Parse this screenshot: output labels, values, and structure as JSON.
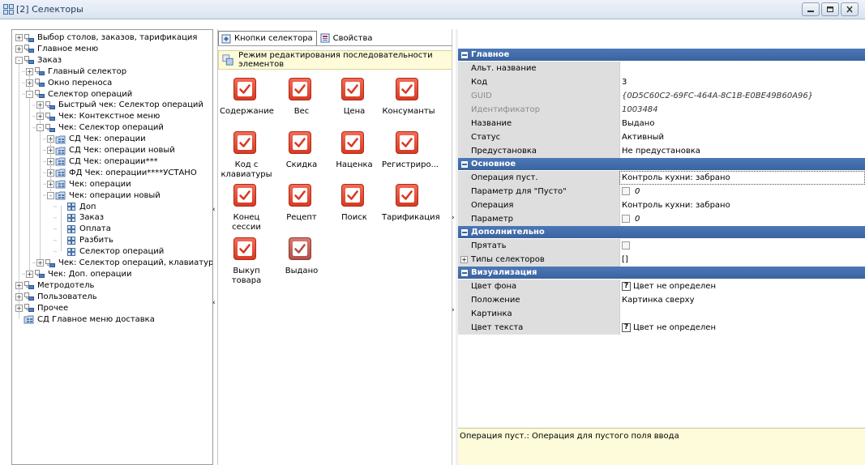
{
  "window": {
    "title": "[2] Селекторы",
    "icon": "grid-icon"
  },
  "tree": {
    "items": [
      {
        "label": "Выбор столов, заказов, тарификация",
        "expander": "+",
        "icon": "folder-icon"
      },
      {
        "label": "Главное меню",
        "expander": "+",
        "icon": "folder-icon"
      },
      {
        "label": "Заказ",
        "expander": "-",
        "icon": "folder-icon"
      },
      {
        "label": "Главный селектор",
        "expander": "+",
        "icon": "folder-icon"
      },
      {
        "label": "Окно переноса",
        "expander": "+",
        "icon": "folder-icon"
      },
      {
        "label": "Селектор операций",
        "expander": "-",
        "icon": "folder-icon"
      },
      {
        "label": "Быстрый чек: Селектор операций",
        "expander": "+",
        "icon": "folder-icon"
      },
      {
        "label": "Чек: Контекстное меню",
        "expander": "+",
        "icon": "folder-icon"
      },
      {
        "label": "Чек: Селектор операций",
        "expander": "-",
        "icon": "folder-icon"
      },
      {
        "label": "СД Чек: операции",
        "expander": "+",
        "icon": "grid-folder-icon"
      },
      {
        "label": "СД Чек: операции новый",
        "expander": "+",
        "icon": "grid-folder-icon"
      },
      {
        "label": "СД Чек: операции***",
        "expander": "+",
        "icon": "grid-folder-icon"
      },
      {
        "label": "ФД Чек: операции****УСТАНО",
        "expander": "+",
        "icon": "grid-folder-icon"
      },
      {
        "label": "Чек: операции",
        "expander": "+",
        "icon": "grid-folder-icon"
      },
      {
        "label": "Чек: операции новый",
        "expander": "-",
        "icon": "grid-folder-icon"
      },
      {
        "label": "Доп",
        "expander": "",
        "icon": "grid-icon"
      },
      {
        "label": "Заказ",
        "expander": "",
        "icon": "grid-icon"
      },
      {
        "label": "Оплата",
        "expander": "",
        "icon": "grid-icon"
      },
      {
        "label": "Разбить",
        "expander": "",
        "icon": "grid-icon"
      },
      {
        "label": "Селектор операций",
        "expander": "",
        "icon": "grid-icon"
      },
      {
        "label": "Чек: Селектор операций, клавиатура",
        "expander": "+",
        "icon": "folder-icon"
      },
      {
        "label": "Чек: Доп. операции",
        "expander": "+",
        "icon": "folder-icon"
      },
      {
        "label": "Метродотель",
        "expander": "+",
        "icon": "folder-icon"
      },
      {
        "label": "Пользователь",
        "expander": "+",
        "icon": "folder-icon"
      },
      {
        "label": "Прочее",
        "expander": "+",
        "icon": "folder-icon"
      },
      {
        "label": "СД Главное меню доставка",
        "expander": "",
        "icon": "grid-folder-icon"
      }
    ]
  },
  "tabs": [
    {
      "label": "Кнопки селектора",
      "icon": "selector-buttons-icon",
      "active": true
    },
    {
      "label": "Свойства",
      "icon": "properties-icon",
      "active": false
    }
  ],
  "mode_bar": {
    "text": "Режим редактирования последовательности элементов",
    "icon": "sequence-edit-icon"
  },
  "selector_buttons": [
    {
      "label": "Содержание",
      "state": "enabled"
    },
    {
      "label": "Вес",
      "state": "enabled"
    },
    {
      "label": "Цена",
      "state": "enabled"
    },
    {
      "label": "Консуманты",
      "state": "enabled"
    },
    {
      "label": "Код с клавиатуры",
      "state": "enabled"
    },
    {
      "label": "Скидка",
      "state": "enabled"
    },
    {
      "label": "Наценка",
      "state": "enabled"
    },
    {
      "label": "Регистриро...",
      "state": "enabled"
    },
    {
      "label": "Конец сессии",
      "state": "enabled"
    },
    {
      "label": "Рецепт",
      "state": "enabled"
    },
    {
      "label": "Поиск",
      "state": "enabled"
    },
    {
      "label": "Тарификация",
      "state": "enabled"
    },
    {
      "label": "Выкуп товара",
      "state": "enabled"
    },
    {
      "label": "Выдано",
      "state": "disabled"
    }
  ],
  "properties": {
    "sections": [
      {
        "title": "Главное",
        "rows": [
          {
            "name": "Альт. название",
            "value": ""
          },
          {
            "name": "Код",
            "value": "3"
          },
          {
            "name": "GUID",
            "value": "{0D5C60C2-69FC-464A-8C1B-E0BE49B60A96}",
            "muted": true,
            "italic": true
          },
          {
            "name": "Идентификатор",
            "value": "1003484",
            "muted": true,
            "italic": true
          },
          {
            "name": "Название",
            "value": "Выдано"
          },
          {
            "name": "Статус",
            "value": "Активный"
          },
          {
            "name": "Предустановка",
            "value": "Не предустановка"
          }
        ]
      },
      {
        "title": "Основное",
        "rows": [
          {
            "name": "Операция пуст.",
            "value": "Контроль кухни: забрано",
            "selected": true
          },
          {
            "name": "Параметр для \"Пусто\"",
            "value": "0",
            "checkbox": true
          },
          {
            "name": "Операция",
            "value": "Контроль кухни: забрано"
          },
          {
            "name": "Параметр",
            "value": "0",
            "checkbox": true
          }
        ]
      },
      {
        "title": "Дополнительно",
        "rows": [
          {
            "name": "Прятать",
            "value": "",
            "checkbox": true
          },
          {
            "name": "Типы селекторов",
            "value": "[]",
            "expander": "+"
          }
        ]
      },
      {
        "title": "Визуализация",
        "rows": [
          {
            "name": "Цвет фона",
            "value": "Цвет не определен",
            "badge": "?"
          },
          {
            "name": "Положение",
            "value": "Картинка сверху"
          },
          {
            "name": "Картинка",
            "value": ""
          },
          {
            "name": "Цвет текста",
            "value": "Цвет не определен",
            "badge": "?"
          }
        ]
      }
    ]
  },
  "help": {
    "text": "Операция пуст.: Операция для пустого поля ввода"
  },
  "colors": {
    "section_header": "#3f6aa6",
    "button_red": "#e2492f",
    "help_background": "#fdfbd9"
  }
}
